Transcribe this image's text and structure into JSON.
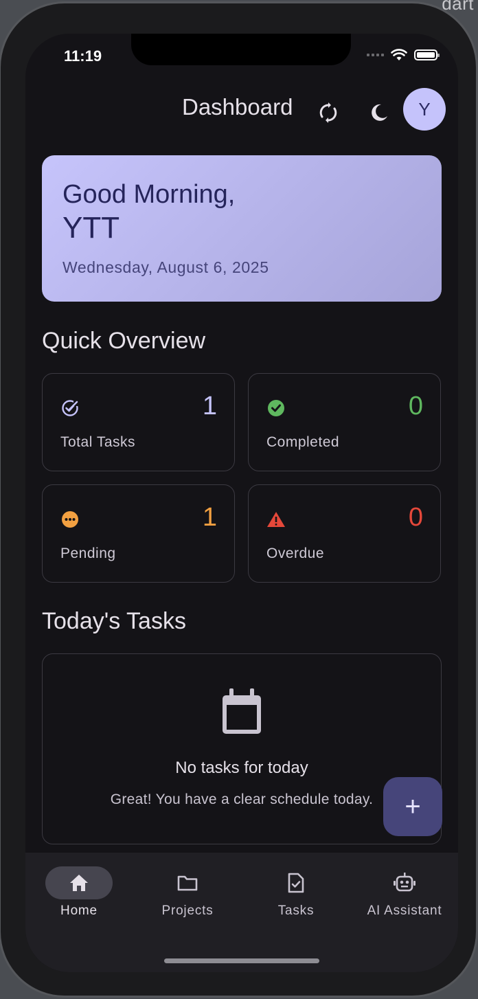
{
  "status_bar": {
    "time": "11:19"
  },
  "app_bar": {
    "title": "Dashboard",
    "avatar_letter": "Y"
  },
  "greeting": {
    "line1": "Good Morning,",
    "name": "YTT",
    "date": "Wednesday, August 6, 2025"
  },
  "overview": {
    "title": "Quick Overview",
    "cards": [
      {
        "label": "Total Tasks",
        "value": "1",
        "icon": "check-circle-outline-icon",
        "color": "#c5c3fb"
      },
      {
        "label": "Completed",
        "value": "0",
        "icon": "check-circle-filled-icon",
        "color": "#5fb85f"
      },
      {
        "label": "Pending",
        "value": "1",
        "icon": "pending-dots-icon",
        "color": "#f2a041"
      },
      {
        "label": "Overdue",
        "value": "0",
        "icon": "warning-triangle-icon",
        "color": "#e5483a"
      }
    ]
  },
  "today": {
    "title": "Today's Tasks",
    "empty_title": "No tasks for today",
    "empty_subtitle": "Great! You have a clear schedule today."
  },
  "fab": {
    "label": "+"
  },
  "nav": {
    "items": [
      {
        "label": "Home",
        "icon": "home-icon",
        "active": true
      },
      {
        "label": "Projects",
        "icon": "folder-icon",
        "active": false
      },
      {
        "label": "Tasks",
        "icon": "task-checklist-icon",
        "active": false
      },
      {
        "label": "AI Assistant",
        "icon": "robot-icon",
        "active": false
      }
    ]
  },
  "background": {
    "window_text": "dart"
  },
  "colors": {
    "accent": "#c5c3fb",
    "surface": "#141317",
    "nav_surface": "#201f24",
    "fab": "#46457a"
  }
}
